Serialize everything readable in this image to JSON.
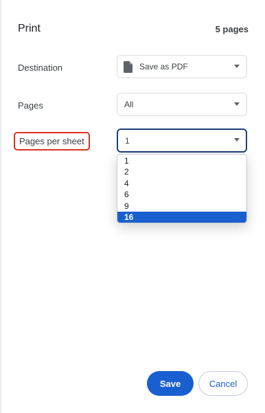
{
  "header": {
    "title": "Print",
    "page_count": "5 pages"
  },
  "destination": {
    "label": "Destination",
    "value": "Save as PDF",
    "icon": "document-icon"
  },
  "pages": {
    "label": "Pages",
    "value": "All"
  },
  "pages_per_sheet": {
    "label": "Pages per sheet",
    "value": "1",
    "options": [
      "1",
      "2",
      "4",
      "6",
      "9",
      "16"
    ],
    "highlighted_option": "16",
    "highlight_color": "#d93025"
  },
  "actions": {
    "save_label": "Save",
    "cancel_label": "Cancel"
  },
  "colors": {
    "accent": "#1a5fd0"
  }
}
